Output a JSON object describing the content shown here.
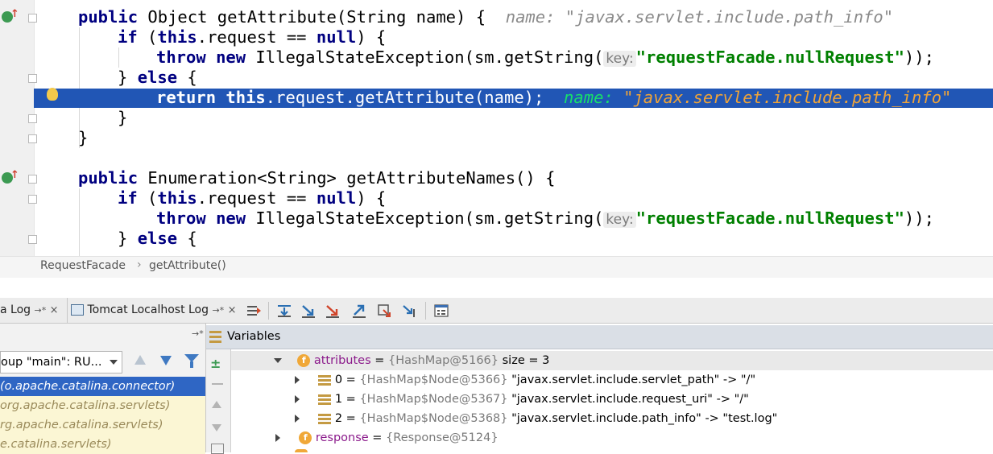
{
  "editor": {
    "line1_kw": "public",
    "line1_sig": " Object getAttribute(String name) {",
    "line1_hint": "name: \"javax.servlet.include.path_info\"",
    "line2_kw1": "if",
    "line2_a": " (",
    "line2_kw2": "this",
    "line2_b": ".request == ",
    "line2_kw3": "null",
    "line2_c": ") {",
    "line3_kw1": "throw",
    "line3_kw2": "new",
    "line3_a": " IllegalStateException(sm.getString(",
    "line3_hint": "key:",
    "line3_str": "\"requestFacade.nullRequest\"",
    "line3_end": "));",
    "line4_a": "} ",
    "line4_kw": "else",
    "line4_b": " {",
    "line5_kw1": "return",
    "line5_kw2": "this",
    "line5_a": ".request.getAttribute(name);",
    "line5_hint_name": "name:",
    "line5_hint_val": "\"javax.servlet.include.path_info\"",
    "line6": "}",
    "line7": "}",
    "line9_kw": "public",
    "line9_sig": " Enumeration<String> getAttributeNames() {",
    "line10_kw1": "if",
    "line10_a": " (",
    "line10_kw2": "this",
    "line10_b": ".request == ",
    "line10_kw3": "null",
    "line10_c": ") {",
    "line11_kw1": "throw",
    "line11_kw2": "new",
    "line11_a": " IllegalStateException(sm.getString(",
    "line11_hint": "key:",
    "line11_str": "\"requestFacade.nullRequest\"",
    "line11_end": "));",
    "line12_a": "} ",
    "line12_kw": "else",
    "line12_b": " {"
  },
  "breadcrumb": {
    "class": "RequestFacade",
    "method": "getAttribute()"
  },
  "tabs": {
    "tab1": "a Log",
    "tab2": "Tomcat Localhost Log"
  },
  "frames": {
    "thread_select": "oup \"main\": RU...",
    "items": [
      "(o.apache.catalina.connector)",
      "org.apache.catalina.servlets)",
      "rg.apache.catalina.servlets)",
      "e.catalina.servlets)"
    ]
  },
  "variables": {
    "header": "Variables",
    "rows": [
      {
        "name": "attributes",
        "eq": " = ",
        "type": "{HashMap@5166}",
        "extra": " size = 3"
      },
      {
        "name": "0",
        "eq": " = ",
        "type": "{HashMap$Node@5366}",
        "extra": " \"javax.servlet.include.servlet_path\" -> \"/\""
      },
      {
        "name": "1",
        "eq": " = ",
        "type": "{HashMap$Node@5367}",
        "extra": " \"javax.servlet.include.request_uri\" -> \"/\""
      },
      {
        "name": "2",
        "eq": " = ",
        "type": "{HashMap$Node@5368}",
        "extra": " \"javax.servlet.include.path_info\" -> \"test.log\""
      },
      {
        "name": "response",
        "eq": " = ",
        "type": "{Response@5124}",
        "extra": ""
      }
    ]
  },
  "colors": {
    "highlight": "#2156b5",
    "keyword": "#000080",
    "string": "#008000"
  }
}
